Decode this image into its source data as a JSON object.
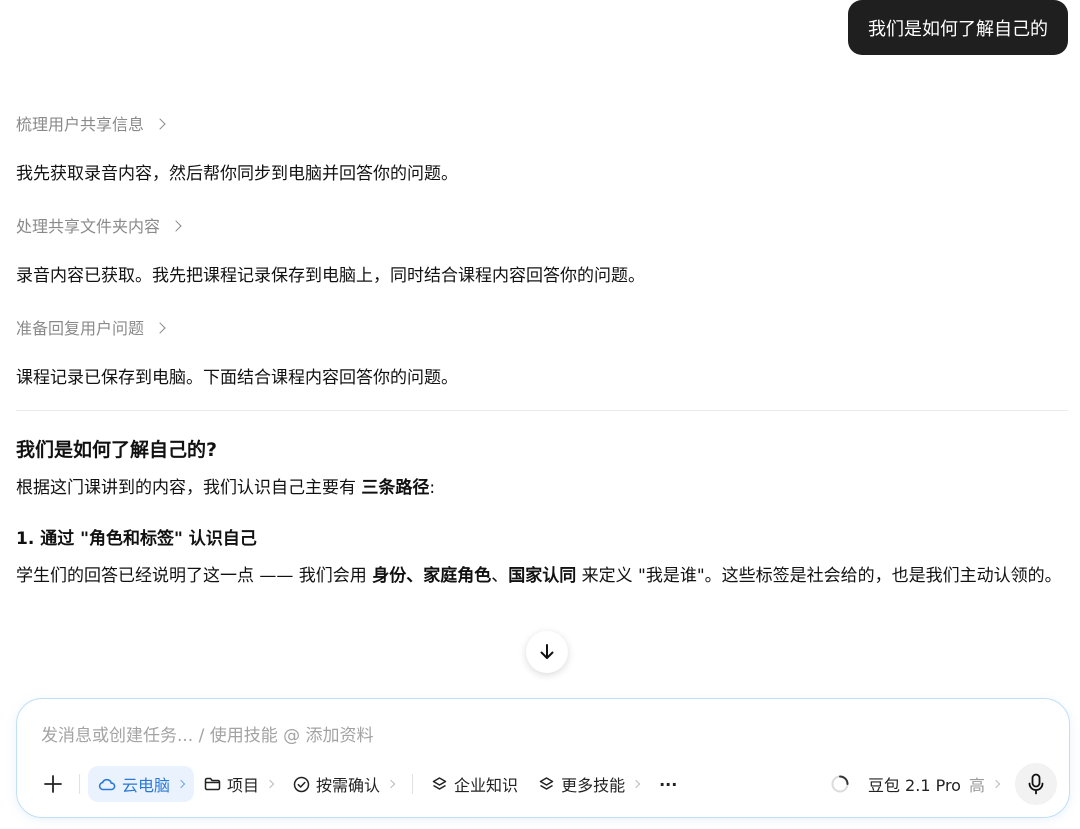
{
  "user_message": "我们是如何了解自己的",
  "steps": [
    {
      "label": "梳理用户共享信息",
      "text": "我先获取录音内容，然后帮你同步到电脑并回答你的问题。"
    },
    {
      "label": "处理共享文件夹内容",
      "text": "录音内容已获取。我先把课程记录保存到电脑上，同时结合课程内容回答你的问题。"
    },
    {
      "label": "准备回复用户问题",
      "text": "课程记录已保存到电脑。下面结合课程内容回答你的问题。"
    }
  ],
  "answer": {
    "title": "我们是如何了解自己的?",
    "intro_prefix": "根据这门课讲到的内容，我们认识自己主要有 ",
    "intro_bold": "三条路径",
    "intro_suffix": ":",
    "section1_title": "1. 通过 \"角色和标签\" 认识自己",
    "section1_p1": "学生们的回答已经说明了这一点 —— 我们会用 ",
    "section1_b1": "身份、家庭角色",
    "section1_p2": "、",
    "section1_b2": "国家认同",
    "section1_p3": " 来定义 \"我是谁\"。这些标签是社会给的，也是我们主动认领的。"
  },
  "input": {
    "placeholder": "发消息或创建任务... / 使用技能 @ 添加资料"
  },
  "toolbar": {
    "cloud_pc": "云电脑",
    "project": "项目",
    "confirm": "按需确认",
    "enterprise": "企业知识",
    "more_skills": "更多技能",
    "more": "···",
    "model": "豆包 2.1 Pro",
    "model_level": "高"
  },
  "colors": {
    "accent": "#2a78d8",
    "bubble": "#1f1f1f",
    "input_border": "#bfe0f7"
  }
}
